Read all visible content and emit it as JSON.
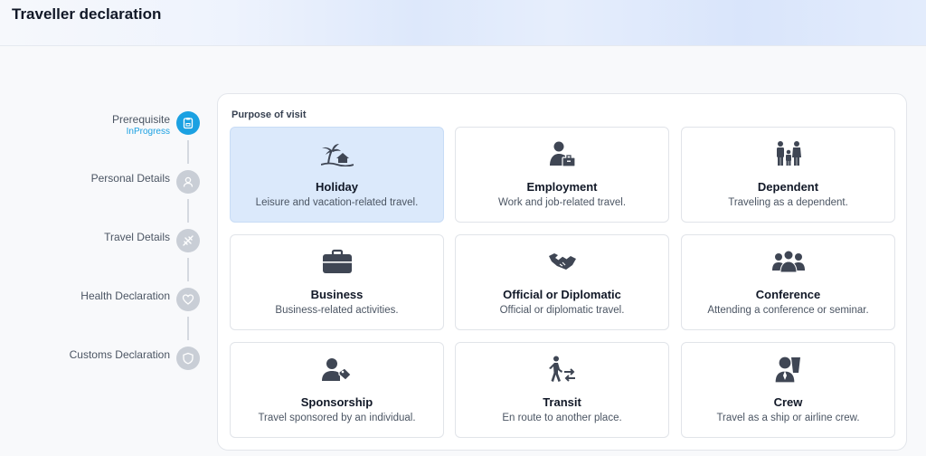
{
  "header": {
    "title": "Traveller declaration"
  },
  "steps": [
    {
      "label": "Prerequisite",
      "status": "InProgress",
      "icon": "clipboard-icon"
    },
    {
      "label": "Personal Details",
      "icon": "person-icon"
    },
    {
      "label": "Travel Details",
      "icon": "plane-icon"
    },
    {
      "label": "Health Declaration",
      "icon": "heart-icon"
    },
    {
      "label": "Customs Declaration",
      "icon": "shield-icon"
    }
  ],
  "purpose": {
    "title": "Purpose of visit",
    "options": [
      {
        "title": "Holiday",
        "desc": "Leisure and vacation-related travel.",
        "icon": "beach-icon",
        "selected": true
      },
      {
        "title": "Employment",
        "desc": "Work and job-related travel.",
        "icon": "employee-icon"
      },
      {
        "title": "Dependent",
        "desc": "Traveling as a dependent.",
        "icon": "family-icon"
      },
      {
        "title": "Business",
        "desc": "Business-related activities.",
        "icon": "briefcase-icon"
      },
      {
        "title": "Official or Diplomatic",
        "desc": "Official or diplomatic travel.",
        "icon": "handshake-icon"
      },
      {
        "title": "Conference",
        "desc": "Attending a conference or seminar.",
        "icon": "group-icon"
      },
      {
        "title": "Sponsorship",
        "desc": "Travel sponsored by an individual.",
        "icon": "sponsor-icon"
      },
      {
        "title": "Transit",
        "desc": "En route to another place.",
        "icon": "transit-icon"
      },
      {
        "title": "Crew",
        "desc": "Travel as a ship or airline crew.",
        "icon": "crew-icon"
      }
    ]
  },
  "colors": {
    "accent": "#1ba1e2",
    "selected_bg": "#dbe9fb",
    "icon": "#3f4654"
  }
}
